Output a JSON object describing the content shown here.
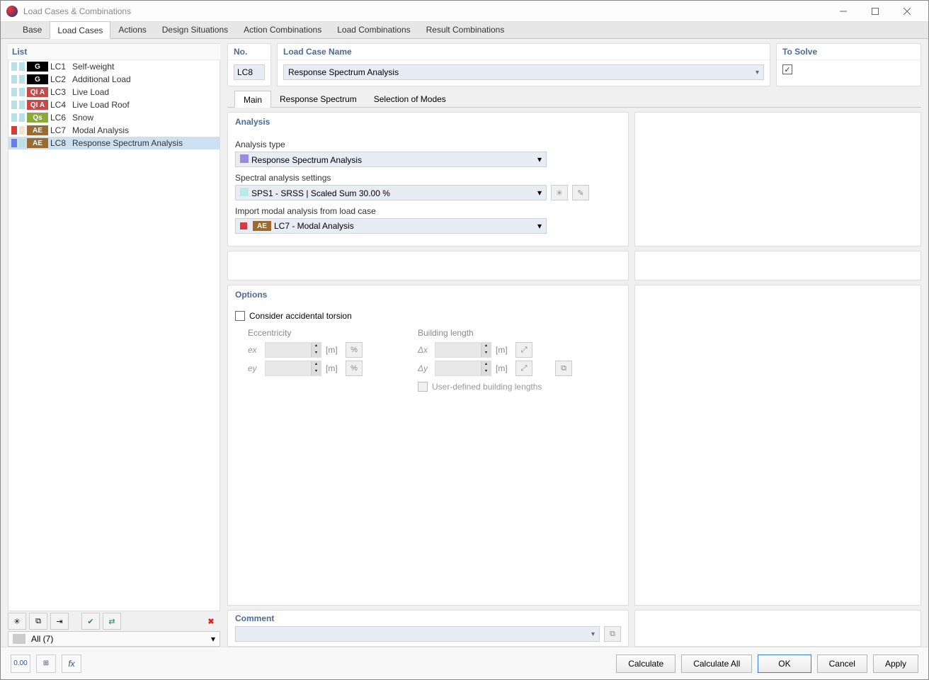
{
  "window": {
    "title": "Load Cases & Combinations"
  },
  "tabs": [
    "Base",
    "Load Cases",
    "Actions",
    "Design Situations",
    "Action Combinations",
    "Load Combinations",
    "Result Combinations"
  ],
  "activeTab": 1,
  "listHeader": "List",
  "loadCases": [
    {
      "code": "LC1",
      "name": "Self-weight",
      "badge": "G",
      "color1": "#b8e0e8",
      "color2": "#b8e0e8",
      "badgeBg": "#000000"
    },
    {
      "code": "LC2",
      "name": "Additional Load",
      "badge": "G",
      "color1": "#b8e0e8",
      "color2": "#b8e0e8",
      "badgeBg": "#000000"
    },
    {
      "code": "LC3",
      "name": "Live Load",
      "badge": "QI A",
      "color1": "#b8e0e8",
      "color2": "#b8e0e8",
      "badgeBg": "#c84848"
    },
    {
      "code": "LC4",
      "name": "Live Load Roof",
      "badge": "QI A",
      "color1": "#b8e0e8",
      "color2": "#b8e0e8",
      "badgeBg": "#c84848"
    },
    {
      "code": "LC6",
      "name": "Snow",
      "badge": "Qs",
      "color1": "#b8e0e8",
      "color2": "#b8e0e8",
      "badgeBg": "#8aaa3a"
    },
    {
      "code": "LC7",
      "name": "Modal Analysis",
      "badge": "AE",
      "color1": "#d63a3a",
      "color2": "#ebe6d8",
      "badgeBg": "#9a6a30"
    },
    {
      "code": "LC8",
      "name": "Response Spectrum Analysis",
      "badge": "AE",
      "color1": "#6a80e0",
      "color2": "#b8e0e8",
      "badgeBg": "#9a6a30",
      "selected": true
    }
  ],
  "filter": "All (7)",
  "header": {
    "noLabel": "No.",
    "no": "LC8",
    "nameLabel": "Load Case Name",
    "name": "Response Spectrum Analysis",
    "solveLabel": "To Solve",
    "solve": true
  },
  "subtabs": [
    "Main",
    "Response Spectrum",
    "Selection of Modes"
  ],
  "activeSubtab": 0,
  "analysis": {
    "title": "Analysis",
    "typeLabel": "Analysis type",
    "type": "Response Spectrum Analysis",
    "typeColor": "#9a8ae0",
    "settingsLabel": "Spectral analysis settings",
    "settings": "SPS1 - SRSS | Scaled Sum 30.00 %",
    "settingsColor": "#bde8e8",
    "importLabel": "Import modal analysis from load case",
    "importColor1": "#d63a3a",
    "importBadge": "AE",
    "importBadgeBg": "#9a6a30",
    "import": "LC7 - Modal Analysis"
  },
  "options": {
    "title": "Options",
    "torsionLabel": "Consider accidental torsion",
    "torsion": false,
    "eccTitle": "Eccentricity",
    "ex": "ex",
    "ey": "ey",
    "blTitle": "Building length",
    "dx": "Δx",
    "dy": "Δy",
    "unit": "[m]",
    "userDefLabel": "User-defined building lengths"
  },
  "comment": {
    "title": "Comment",
    "value": ""
  },
  "buttons": {
    "calculate": "Calculate",
    "calculateAll": "Calculate All",
    "ok": "OK",
    "cancel": "Cancel",
    "apply": "Apply"
  }
}
